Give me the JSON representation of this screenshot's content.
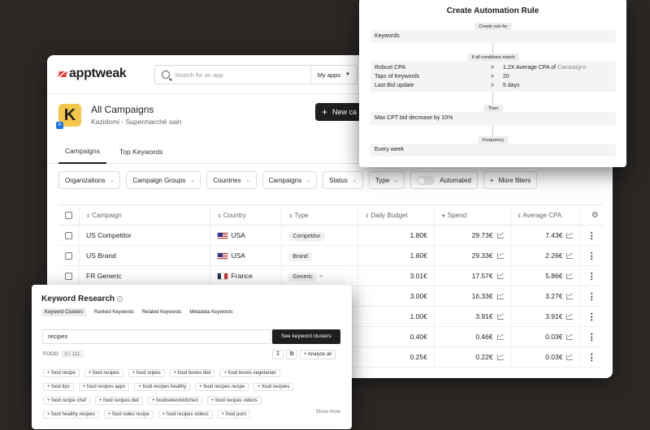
{
  "header": {
    "logo": "apptweak",
    "search_placeholder": "Search for an app",
    "my_apps": "My apps"
  },
  "app": {
    "title": "All Campaigns",
    "subtitle": "Kazidomi - Supermarché sain",
    "icon_letter": "K",
    "new_button": "New ca"
  },
  "tabs": [
    {
      "label": "Campaigns",
      "active": true
    },
    {
      "label": "Top Keywords",
      "active": false
    }
  ],
  "filters": {
    "organizations": "Organizations",
    "campaign_groups": "Campaign Groups",
    "countries": "Countries",
    "campaigns": "Campaigns",
    "status": "Status",
    "type": "Type",
    "automated": "Automated",
    "more_filters": "More filters"
  },
  "table": {
    "headers": {
      "campaign": "Campaign",
      "country": "Country",
      "type": "Type",
      "daily_budget": "Daily Budget",
      "spend": "Spend",
      "avg_cpa": "Average CPA"
    },
    "rows": [
      {
        "campaign": "US Competitor",
        "country": "USA",
        "type": "Competitor",
        "budget": "1.80€",
        "spend": "29.73€",
        "cpa": "7.43€"
      },
      {
        "campaign": "US Brand",
        "country": "USA",
        "type": "Brand",
        "budget": "1.80€",
        "spend": "29.33€",
        "cpa": "2.26€"
      },
      {
        "campaign": "FR Generic",
        "country": "France",
        "type": "Generic",
        "budget": "3.01€",
        "spend": "17.57€",
        "cpa": "5.86€"
      },
      {
        "campaign": "",
        "country": "",
        "type": "",
        "budget": "3.00€",
        "spend": "16.33€",
        "cpa": "3.27€"
      },
      {
        "campaign": "",
        "country": "",
        "type": "",
        "budget": "1.00€",
        "spend": "3.91€",
        "cpa": "3.91€"
      },
      {
        "campaign": "",
        "country": "",
        "type": "",
        "budget": "0.40€",
        "spend": "0.46€",
        "cpa": "0.03€"
      },
      {
        "campaign": "",
        "country": "",
        "type": "",
        "budget": "0.25€",
        "spend": "0.22€",
        "cpa": "0.03€"
      }
    ]
  },
  "automation": {
    "title": "Create Automation Rule",
    "create_for": "Create rule for",
    "target": "Keywords",
    "if_all": "If all conditions match",
    "conditions": [
      {
        "key": "Robust CPA",
        "op": ">",
        "value": "1.2X Average CPA of ",
        "link": "Campaigns"
      },
      {
        "key": "Taps of Keywords",
        "op": ">",
        "value": "20",
        "link": ""
      },
      {
        "key": "Last Bid update",
        "op": ">",
        "value": "5 days",
        "link": ""
      }
    ],
    "then": "Then",
    "action": "Max CPT bid decrease by 10%",
    "frequency_label": "Frequency",
    "frequency": "Every week"
  },
  "keyword_research": {
    "title": "Keyword Research",
    "tabs": [
      "Keyword Clusters",
      "Ranked Keywords",
      "Related Keywords",
      "Metadata Keywords"
    ],
    "search_value": "recipes",
    "see_button": "See keyword clusters",
    "cluster": "FOOD",
    "cluster_count": "0 / 111",
    "analyze": "Analyze all",
    "chips": [
      [
        "food recipe",
        "food recipes",
        "food reipes",
        "food boxes diet",
        "food boxes vegetarian"
      ],
      [
        "food tips",
        "food recipes apps",
        "food recipes healthy",
        "food recipes recipe",
        "food recipies"
      ],
      [
        "food recipe chef",
        "food recipes diet",
        "foodnetworkkitchen",
        "food recipes videos"
      ],
      [
        "food healthy recipes",
        "food video recipe",
        "food recipes videos",
        "food porn"
      ]
    ],
    "show_more": "Show more"
  }
}
